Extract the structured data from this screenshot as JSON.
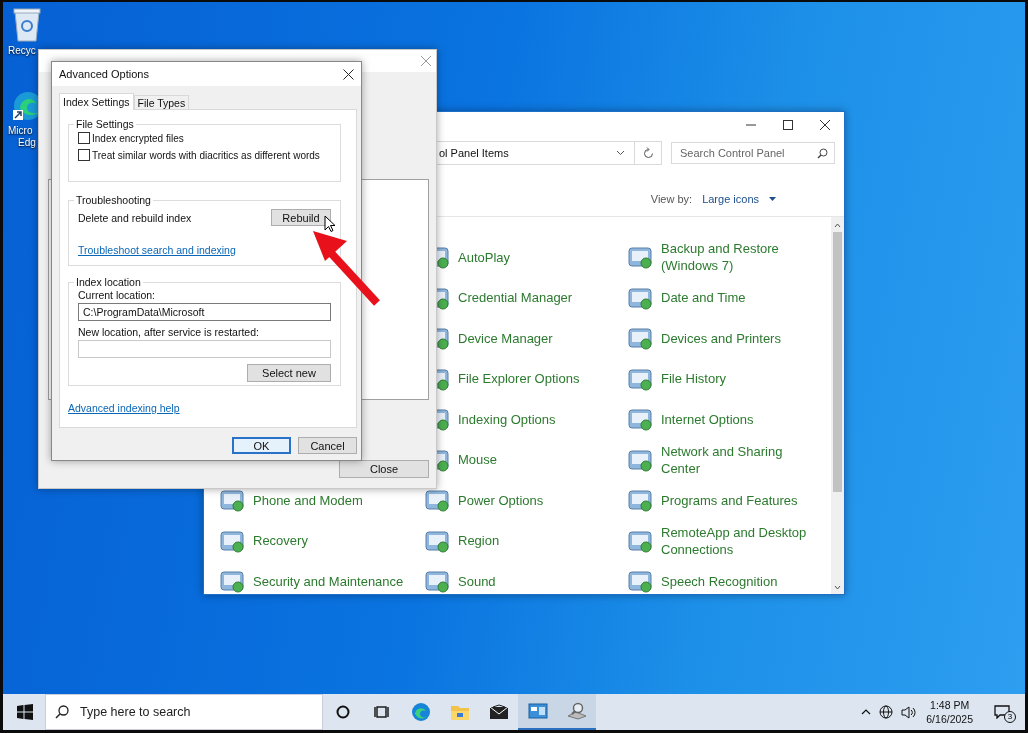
{
  "desktop_icons": [
    {
      "kind": "recycle-bin",
      "lines": [
        "Recyc"
      ]
    },
    {
      "kind": "edge",
      "lines": [
        "Micro",
        "Edg"
      ]
    }
  ],
  "indexing_window": {
    "close_button": "Close"
  },
  "control_panel": {
    "address": "ol Panel Items",
    "search": {
      "placeholder": "Search Control Panel"
    },
    "view_by": {
      "label": "View by:",
      "value": "Large icons"
    },
    "columns": [
      {
        "items": [
          "Phone and Modem",
          "Recovery",
          "Security and Maintenance"
        ]
      },
      {
        "items": [
          "AutoPlay",
          "Credential Manager",
          "Device Manager",
          "File Explorer Options",
          "Indexing Options",
          "Mouse",
          "Power Options",
          "Region",
          "Sound"
        ]
      },
      {
        "items": [
          "Backup and Restore (Windows 7)",
          "Date and Time",
          "Devices and Printers",
          "File History",
          "Internet Options",
          "Network and Sharing Center",
          "Programs and Features",
          "RemoteApp and Desktop Connections",
          "Speech Recognition"
        ]
      }
    ]
  },
  "advanced": {
    "title": "Advanced Options",
    "tabs": [
      {
        "label": "Index Settings",
        "selected": true
      },
      {
        "label": "File Types",
        "selected": false
      }
    ],
    "file_settings": {
      "title": "File Settings",
      "options": [
        {
          "label": "Index encrypted files",
          "checked": false
        },
        {
          "label": "Treat similar words with diacritics as different words",
          "checked": false
        }
      ]
    },
    "troubleshooting": {
      "title": "Troubleshooting",
      "label": "Delete and rebuild index",
      "button": "Rebuild",
      "link": "Troubleshoot search and indexing"
    },
    "index_location": {
      "title": "Index location",
      "current_label": "Current location:",
      "current_value": "C:\\ProgramData\\Microsoft",
      "new_label": "New location, after service is restarted:",
      "button": "Select new"
    },
    "help_link": "Advanced indexing help",
    "buttons": [
      {
        "label": "OK",
        "default": true
      },
      {
        "label": "Cancel",
        "default": false
      }
    ]
  },
  "taskbar": {
    "search_placeholder": "Type here to search",
    "apps": [
      {
        "kind": "cortana",
        "active": false
      },
      {
        "kind": "task-view",
        "active": false
      },
      {
        "kind": "edge",
        "active": false
      },
      {
        "kind": "explorer",
        "active": false
      },
      {
        "kind": "mail",
        "active": false
      },
      {
        "kind": "control-panel",
        "active": true
      },
      {
        "kind": "indexing",
        "active": true
      }
    ],
    "time": "1:48 PM",
    "date": "6/16/2025",
    "notification_count": "3"
  }
}
